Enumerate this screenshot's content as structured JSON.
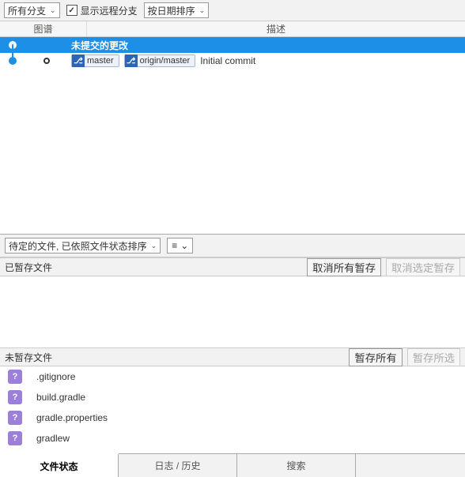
{
  "topbar": {
    "branch_filter": "所有分支",
    "show_remote_label": "显示远程分支",
    "show_remote_checked": true,
    "sort_label": "按日期排序"
  },
  "columns": {
    "graph": "图谱",
    "description": "描述"
  },
  "commits": [
    {
      "message": "未提交的更改",
      "selected": true
    },
    {
      "branches": [
        "master",
        "origin/master"
      ],
      "message": "Initial commit",
      "selected": false
    }
  ],
  "midbar": {
    "pending_sort": "待定的文件, 已依照文件状态排序",
    "view_icon": "≡"
  },
  "staged": {
    "title": "已暂存文件",
    "unstage_all": "取消所有暂存",
    "unstage_selected": "取消选定暂存"
  },
  "unstaged": {
    "title": "未暂存文件",
    "stage_all": "暂存所有",
    "stage_selected": "暂存所选",
    "files": [
      {
        "status": "?",
        "name": ".gitignore"
      },
      {
        "status": "?",
        "name": "build.gradle"
      },
      {
        "status": "?",
        "name": "gradle.properties"
      },
      {
        "status": "?",
        "name": "gradlew"
      }
    ]
  },
  "tabs": {
    "file_status": "文件状态",
    "log_history": "日志 / 历史",
    "search": "搜索"
  }
}
